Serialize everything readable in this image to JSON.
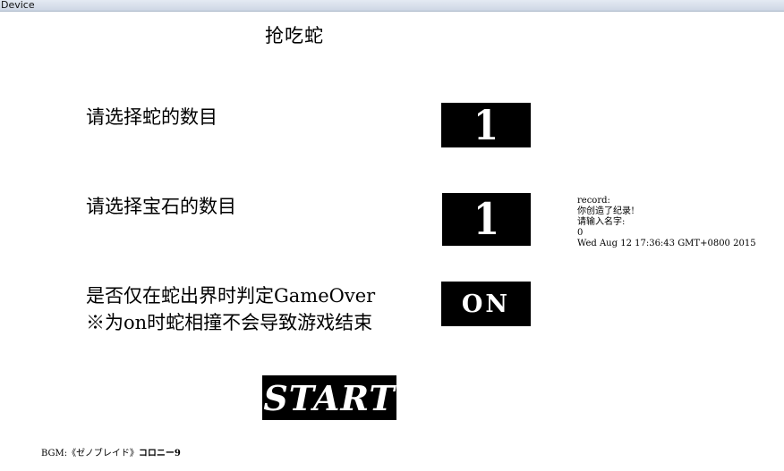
{
  "window": {
    "title": "Device"
  },
  "game": {
    "title": "抢吃蛇"
  },
  "options": {
    "snakes_label": "请选择蛇的数目",
    "snakes_value": "1",
    "gems_label": "请选择宝石的数目",
    "gems_value": "1",
    "gameover_label": "是否仅在蛇出界时判定GameOver",
    "gameover_note": "※为on时蛇相撞不会导致游戏结束",
    "gameover_value": "ON"
  },
  "start": {
    "label": "START"
  },
  "record": {
    "line1": "record:",
    "line2": "你创造了纪录!",
    "line3": "请输入名字:",
    "line4": "0",
    "line5": "Wed Aug 12 17:36:43 GMT+0800 2015"
  },
  "bgm": {
    "prefix": "BGM:《ゼノブレイド》",
    "track": "コロニー9"
  }
}
